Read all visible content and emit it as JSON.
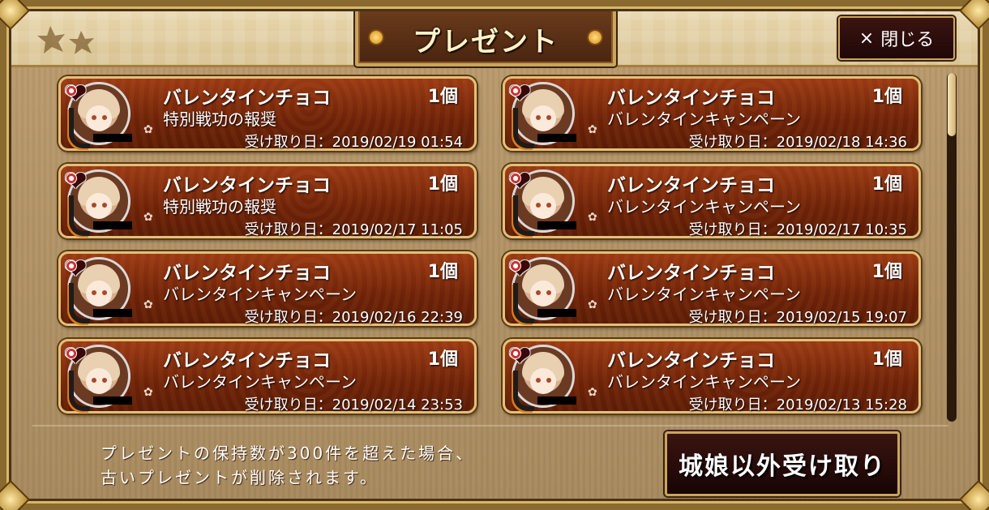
{
  "header": {
    "title": "プレゼント",
    "close_label": "閉じる",
    "close_glyph": "×"
  },
  "presents": [
    {
      "item": "バレンタインチョコ",
      "qty": "1個",
      "source": "特別戦功の報奨",
      "received": "受け取り日：2019/02/19  01:54"
    },
    {
      "item": "バレンタインチョコ",
      "qty": "1個",
      "source": "バレンタインキャンペーン",
      "received": "受け取り日：2019/02/18  14:36"
    },
    {
      "item": "バレンタインチョコ",
      "qty": "1個",
      "source": "特別戦功の報奨",
      "received": "受け取り日：2019/02/17  11:05"
    },
    {
      "item": "バレンタインチョコ",
      "qty": "1個",
      "source": "バレンタインキャンペーン",
      "received": "受け取り日：2019/02/17  10:35"
    },
    {
      "item": "バレンタインチョコ",
      "qty": "1個",
      "source": "バレンタインキャンペーン",
      "received": "受け取り日：2019/02/16  22:39"
    },
    {
      "item": "バレンタインチョコ",
      "qty": "1個",
      "source": "バレンタインキャンペーン",
      "received": "受け取り日：2019/02/15  19:07"
    },
    {
      "item": "バレンタインチョコ",
      "qty": "1個",
      "source": "バレンタインキャンペーン",
      "received": "受け取り日：2019/02/14  23:53"
    },
    {
      "item": "バレンタインチョコ",
      "qty": "1個",
      "source": "バレンタインキャンペーン",
      "received": "受け取り日：2019/02/13  15:28"
    }
  ],
  "footer": {
    "notice_line1": "プレゼントの保持数が300件を超えた場合、",
    "notice_line2": "古いプレゼントが削除されます。",
    "bulk_receive_label": "城娘以外受け取り"
  },
  "icons": {
    "item": "chocolate-heart-icon",
    "portrait": "character-portrait",
    "source_mark": "flower-icon"
  },
  "colors": {
    "card_fill": "#6d2208",
    "card_border": "#e2c07a",
    "frame_gold": "#c9a55a",
    "panel_bg": "#b99a6d"
  }
}
